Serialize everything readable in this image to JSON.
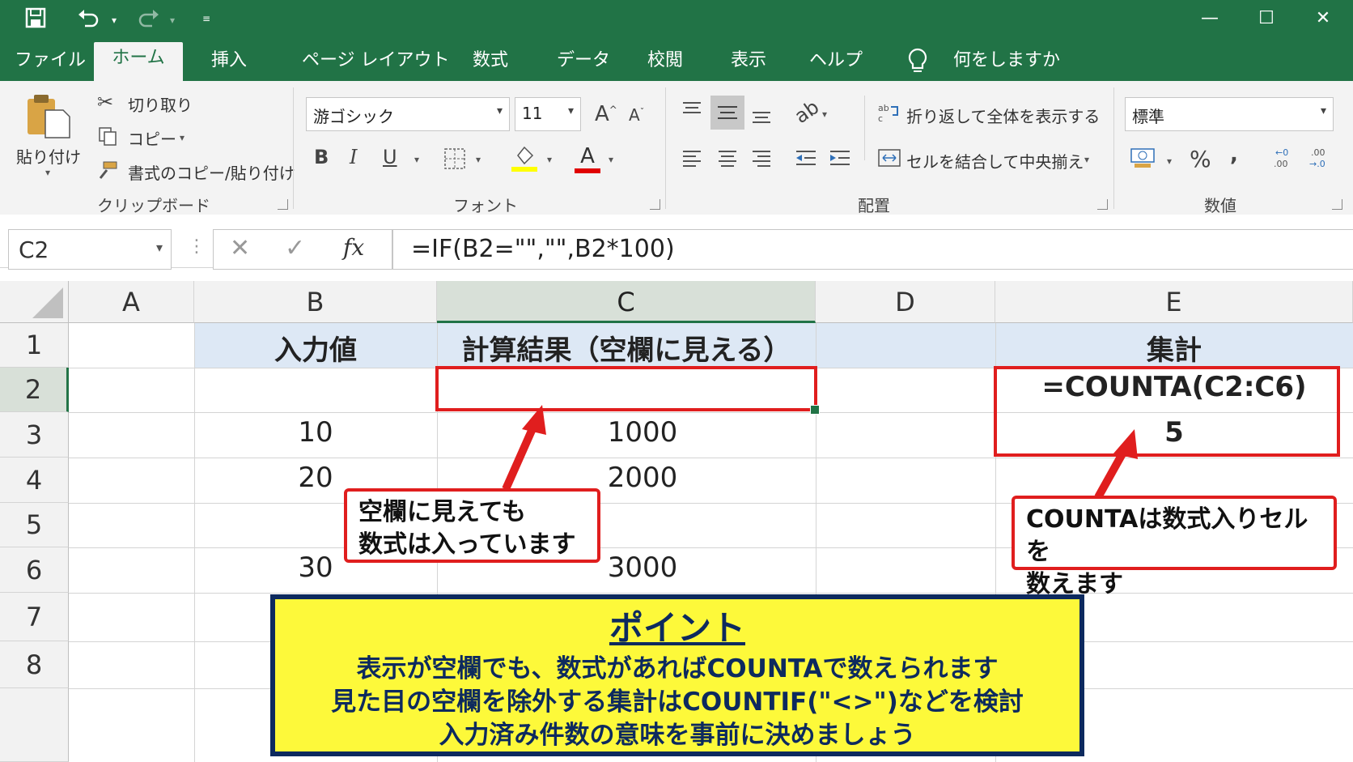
{
  "titlebar": {
    "save_icon": "save-icon",
    "undo_icon": "undo-icon",
    "redo_icon": "redo-icon",
    "minimize": "—",
    "restore": "☐",
    "close": "✕"
  },
  "tabs": [
    {
      "label": "ファイル"
    },
    {
      "label": "ホーム"
    },
    {
      "label": "挿入"
    },
    {
      "label": "ページ レイアウト"
    },
    {
      "label": "数式"
    },
    {
      "label": "データ"
    },
    {
      "label": "校閲"
    },
    {
      "label": "表示"
    },
    {
      "label": "ヘルプ"
    }
  ],
  "tell_me": "何をしますか",
  "clipboard": {
    "paste": "貼り付け",
    "cut": "切り取り",
    "copy": "コピー",
    "format_painter": "書式のコピー/貼り付け",
    "group": "クリップボード"
  },
  "font": {
    "name": "游ゴシック",
    "size": "11",
    "bold": "B",
    "italic": "I",
    "underline": "U",
    "grow": "A",
    "shrink": "A",
    "font_color": "A",
    "group": "フォント",
    "highlight_color": "#ffff00",
    "text_color": "#e00000"
  },
  "alignment": {
    "wrap": "折り返して全体を表示する",
    "merge": "セルを結合して中央揃え",
    "group": "配置"
  },
  "number": {
    "format": "標準",
    "percent": "%",
    "comma": "9",
    "group": "数値"
  },
  "formula_bar": {
    "name_box": "C2",
    "fx": "fx",
    "formula": "=IF(B2=\"\",\"\",B2*100)"
  },
  "grid": {
    "columns": [
      "A",
      "B",
      "C",
      "D",
      "E"
    ],
    "rows": [
      "1",
      "2",
      "3",
      "4",
      "5",
      "6",
      "7",
      "8"
    ],
    "header_row": {
      "B": "入力値",
      "C": "計算結果（空欄に見える）",
      "E": "集計"
    },
    "values": {
      "B3": "10",
      "C3": "1000",
      "B4": "20",
      "C4": "2000",
      "B6": "30",
      "C6": "3000",
      "E2": "=COUNTA(C2:C6)",
      "E3": "5"
    }
  },
  "callouts": {
    "left": [
      "空欄に見えても",
      "数式は入っています"
    ],
    "right": [
      "COUNTAは数式入りセルを",
      "数えます"
    ]
  },
  "point": {
    "title": "ポイント",
    "lines": [
      "表示が空欄でも、数式があればCOUNTAで数えられます",
      "見た目の空欄を除外する集計はCOUNTIF(\"<>\")などを検討",
      "入力済み件数の意味を事前に決めましょう"
    ]
  },
  "colors": {
    "excel_green": "#217346",
    "annotation_red": "#e01e1e",
    "point_bg": "#fdf93a",
    "point_border": "#0d2a5e"
  }
}
